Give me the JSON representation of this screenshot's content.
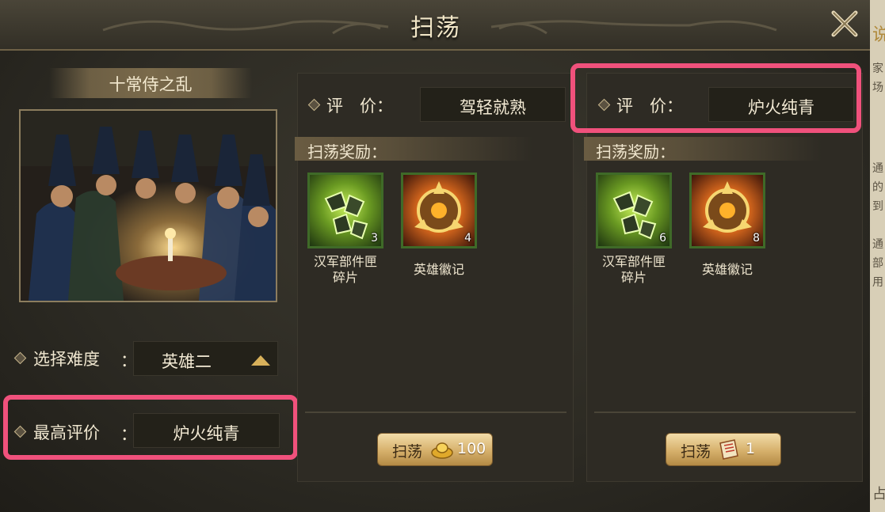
{
  "window": {
    "title": "扫荡"
  },
  "right_strip_chars": [
    "说",
    "家",
    "场",
    "通",
    "的",
    "到",
    "通",
    "部",
    "用",
    "占"
  ],
  "stage": {
    "name": "十常侍之乱",
    "difficulty_label": "选择难度",
    "difficulty_value": "英雄二",
    "best_rating_label": "最高评价",
    "best_rating_value": "炉火纯青",
    "colon": "："
  },
  "panels": [
    {
      "rating_label": "评　价：",
      "rating_value": "驾轻就熟",
      "rewards_title": "扫荡奖励：",
      "rewards": [
        {
          "name_line1": "汉军部件匣",
          "name_line2": "碎片",
          "count": "3",
          "icon": "green-parts-box-icon"
        },
        {
          "name_line1": "英雄徽记",
          "name_line2": "",
          "count": "4",
          "icon": "golden-hero-emblem-icon"
        }
      ],
      "button": {
        "label": "扫荡",
        "cost": "100",
        "cost_icon": "gold-ingot-icon"
      }
    },
    {
      "rating_label": "评　价：",
      "rating_value": "炉火纯青",
      "rewards_title": "扫荡奖励：",
      "rewards": [
        {
          "name_line1": "汉军部件匣",
          "name_line2": "碎片",
          "count": "6",
          "icon": "green-parts-box-icon"
        },
        {
          "name_line1": "英雄徽记",
          "name_line2": "",
          "count": "8",
          "icon": "golden-hero-emblem-icon"
        }
      ],
      "button": {
        "label": "扫荡",
        "cost": "1",
        "cost_icon": "sweep-scroll-icon"
      }
    }
  ],
  "colors": {
    "highlight": "#f0517c",
    "gold_accent": "#d8b15a"
  }
}
